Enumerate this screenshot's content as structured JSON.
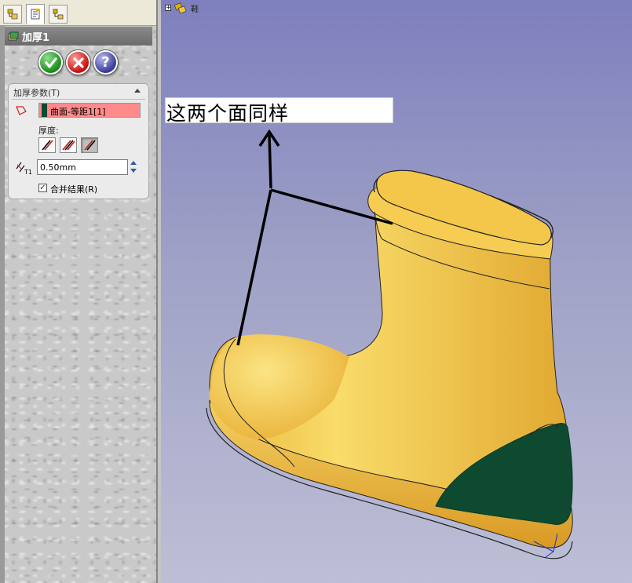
{
  "tabs": [
    {
      "name": "feature-manager",
      "icon": "feature-tree-icon"
    },
    {
      "name": "property-manager",
      "icon": "property-manager-icon"
    },
    {
      "name": "configuration-manager",
      "icon": "configuration-icon"
    }
  ],
  "feature": {
    "title": "加厚1",
    "icon": "thicken-feature-icon"
  },
  "actions": {
    "ok_icon": "checkmark-icon",
    "cancel_icon": "x-icon",
    "help_label": "?"
  },
  "params": {
    "title": "加厚参数(T)",
    "selected_face": "曲面-等距1[1]",
    "face_color": "#0d4a30",
    "thickness_label": "厚度:",
    "thickness_value": "0.50mm",
    "merge_label": "合并结果(R)",
    "merge_checked": true,
    "side_options": [
      "side1-icon",
      "both-sides-icon",
      "side2-icon"
    ],
    "selected_side": 2
  },
  "viewport": {
    "background_top": "#7e7fbe",
    "background_bottom": "#bdbfd6",
    "callout_text": "这两个面同样",
    "model_color": "#f2c542",
    "highlight_face_color": "#0d4a30"
  }
}
